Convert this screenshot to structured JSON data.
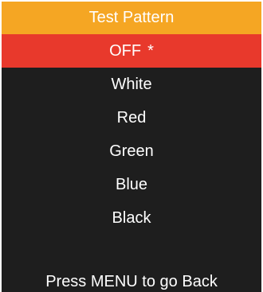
{
  "colors": {
    "title_bg": "#f5a623",
    "selected_bg": "#e8392c",
    "panel_bg": "#1e1e1e",
    "text": "#ffffff"
  },
  "menu": {
    "title": "Test Pattern",
    "items": [
      {
        "label": "OFF",
        "marker": "*",
        "selected": true
      },
      {
        "label": "White"
      },
      {
        "label": "Red"
      },
      {
        "label": "Green"
      },
      {
        "label": "Blue"
      },
      {
        "label": "Black"
      }
    ]
  },
  "footer": {
    "hint": "Press MENU to go Back"
  }
}
